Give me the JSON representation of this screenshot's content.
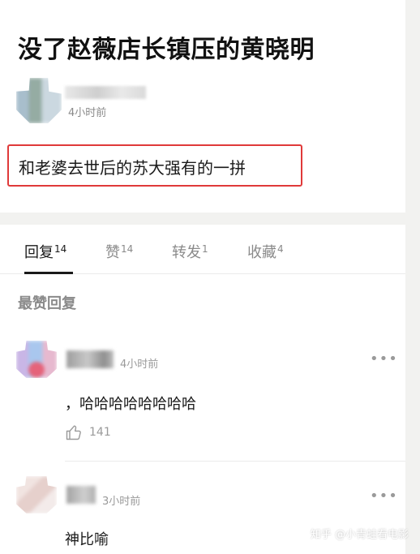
{
  "post": {
    "title": "没了赵薇店长镇压的黄晓明",
    "time": "4小时前",
    "body": "和老婆去世后的苏大强有的一拼"
  },
  "tabs": [
    {
      "label": "回复",
      "count": "14",
      "active": true
    },
    {
      "label": "赞",
      "count": "14",
      "active": false
    },
    {
      "label": "转发",
      "count": "1",
      "active": false
    },
    {
      "label": "收藏",
      "count": "4",
      "active": false
    }
  ],
  "section": {
    "title": "最赞回复"
  },
  "comments": [
    {
      "time": "4小时前",
      "text": "，哈哈哈哈哈哈哈哈",
      "likes": "141",
      "more": "•••"
    },
    {
      "time": "3小时前",
      "text": "神比喻",
      "more": "•••"
    }
  ],
  "watermark": "知乎 @小青蛙看电影",
  "colors": {
    "highlight": "#e03a3a",
    "text": "#1a1a1a",
    "muted": "#8a8a8a",
    "background": "#f2f2f0"
  }
}
